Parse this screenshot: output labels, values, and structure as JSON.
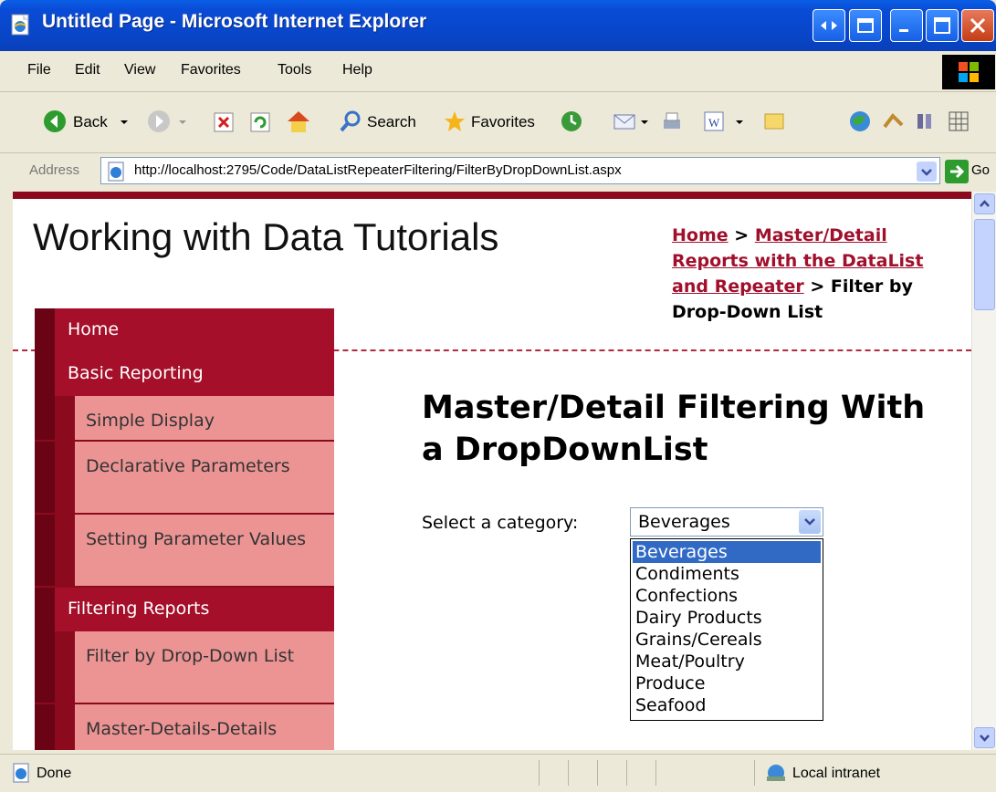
{
  "window": {
    "title": "Untitled Page - Microsoft Internet Explorer"
  },
  "menubar": {
    "items": [
      {
        "label": "File"
      },
      {
        "label": "Edit"
      },
      {
        "label": "View"
      },
      {
        "label": "Favorites"
      },
      {
        "label": "Tools"
      },
      {
        "label": "Help"
      }
    ]
  },
  "toolbar": {
    "back_label": "Back",
    "search_label": "Search",
    "favorites_label": "Favorites"
  },
  "address": {
    "label": "Address",
    "url": "http://localhost:2795/Code/DataListRepeaterFiltering/FilterByDropDownList.aspx",
    "go_label": "Go"
  },
  "page": {
    "site_title": "Working with Data Tutorials",
    "breadcrumb": {
      "home": "Home",
      "separator": ">",
      "parent": "Master/Detail Reports with the DataList and Repeater",
      "current": "> Filter by Drop-Down List"
    },
    "nav": {
      "home": "Home",
      "basic_reporting": "Basic Reporting",
      "simple_display": "Simple Display",
      "declarative_parameters": "Declarative Parameters",
      "setting_parameter_values": "Setting Parameter Values",
      "filtering_reports": "Filtering Reports",
      "filter_by_dropdown": "Filter by Drop-Down List",
      "master_details": "Master-Details-Details"
    },
    "heading": "Master/Detail Filtering With a DropDownList",
    "select_label": "Select a category:",
    "selected_value": "Beverages",
    "options": [
      "Beverages",
      "Condiments",
      "Confections",
      "Dairy Products",
      "Grains/Cereals",
      "Meat/Poultry",
      "Produce",
      "Seafood"
    ]
  },
  "statusbar": {
    "status": "Done",
    "zone": "Local intranet"
  },
  "colors": {
    "accent": "#a50f2a",
    "nav_sub_bg": "#ec9494",
    "selection": "#316ac5"
  }
}
